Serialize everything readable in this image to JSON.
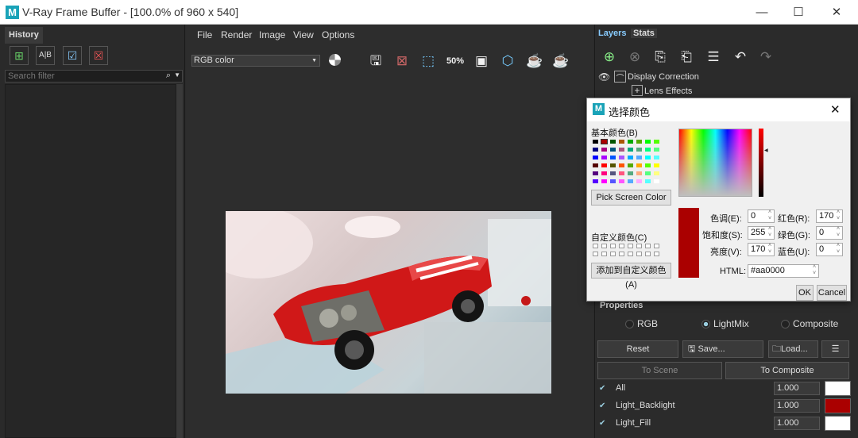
{
  "window": {
    "app_icon": "vray-logo-icon",
    "title": "V-Ray Frame Buffer - [100.0% of 960 x 540]",
    "minimize": "—",
    "maximize": "☐",
    "close": "✕"
  },
  "history": {
    "tab": "History",
    "search_placeholder": "Search filter",
    "toolbar": [
      "add-icon",
      "ab-compare-icon",
      "check-icon",
      "delete-icon"
    ]
  },
  "menu": [
    "File",
    "Render",
    "Image",
    "View",
    "Options"
  ],
  "viewer": {
    "channel": "RGB color",
    "zoom_label": "50%"
  },
  "layers": {
    "tabs": [
      "Layers",
      "Stats"
    ],
    "items": [
      "Display Correction",
      "Lens Effects"
    ]
  },
  "properties": {
    "title": "Properties",
    "modes": [
      "RGB",
      "LightMix",
      "Composite"
    ],
    "selected_mode": "LightMix",
    "buttons": {
      "reset": "Reset",
      "save": "Save...",
      "load": "Load...",
      "to_scene": "To Scene",
      "to_composite": "To Composite"
    },
    "lights": [
      {
        "name": "All",
        "value": "1.000",
        "color": "#ffffff"
      },
      {
        "name": "Light_Backlight",
        "value": "1.000",
        "color": "#aa0000"
      },
      {
        "name": "Light_Fill",
        "value": "1.000",
        "color": "#ffffff"
      }
    ]
  },
  "color_dialog": {
    "title": "选择颜色",
    "basic_colors_label": "基本颜色(B)",
    "custom_colors_label": "自定义颜色(C)",
    "pick_screen": "Pick Screen Color",
    "add_custom": "添加到自定义颜色(A)",
    "hue_label": "色调(E):",
    "hue": "0",
    "sat_label": "饱和度(S):",
    "sat": "255",
    "val_label": "亮度(V):",
    "val": "170",
    "red_label": "红色(R):",
    "red": "170",
    "green_label": "绿色(G):",
    "green": "0",
    "blue_label": "蓝色(U):",
    "blue": "0",
    "html_label": "HTML:",
    "html": "#aa0000",
    "ok": "OK",
    "cancel": "Cancel",
    "current_color": "#aa0000",
    "basic_colors": [
      "#000000",
      "#aa0000",
      "#005500",
      "#aa5500",
      "#00aa00",
      "#55aa00",
      "#00ff00",
      "#55ff00",
      "#00007f",
      "#aa007f",
      "#00557f",
      "#aa557f",
      "#00aa7f",
      "#55aa7f",
      "#00ff7f",
      "#55ff7f",
      "#0000ff",
      "#aa00ff",
      "#0055ff",
      "#aa55ff",
      "#00aaff",
      "#55aaff",
      "#00ffff",
      "#55ffff",
      "#550000",
      "#ff0000",
      "#555500",
      "#ff5500",
      "#55aa00",
      "#ffaa00",
      "#55ff00",
      "#ffff00",
      "#55007f",
      "#ff007f",
      "#55557f",
      "#ff557f",
      "#55aa7f",
      "#ffaa7f",
      "#55ff7f",
      "#ffff7f",
      "#5500ff",
      "#ff00ff",
      "#5555ff",
      "#ff55ff",
      "#55aaff",
      "#ffaaff",
      "#55ffff",
      "#ffffff"
    ]
  }
}
